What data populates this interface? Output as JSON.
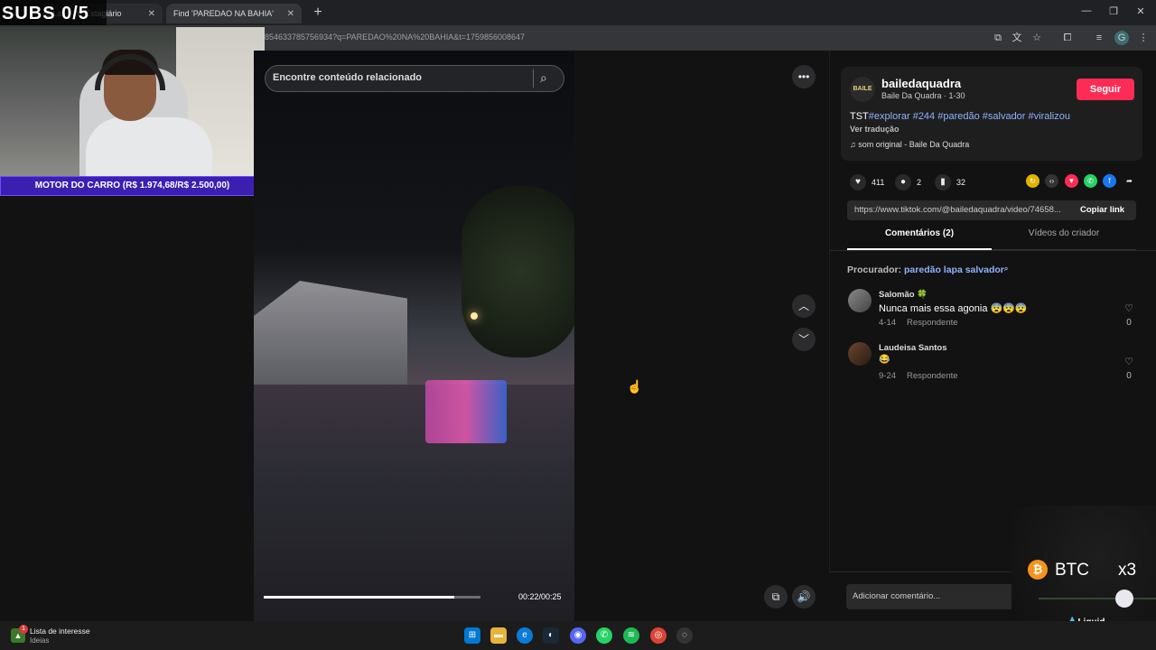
{
  "browser": {
    "tabs": [
      {
        "label": "0) Lar... W: Estagiário",
        "close": "✕"
      },
      {
        "label": "Find 'PAREDAO NA BAHIA'",
        "close": "✕"
      }
    ],
    "url": "854633785756934?q=PAREDAO%20NA%20BAHIA&t=1759856008647"
  },
  "overlay": {
    "subs_counter": "SUBS 0/5",
    "goal": "MOTOR DO CARRO (R$ 1.974,68/R$ 2.500,00)"
  },
  "video": {
    "search_placeholder": "Encontre conteúdo relacionado",
    "time": "00:22/00:25",
    "progress": 0.88
  },
  "post": {
    "username": "bailedaquadra",
    "avatar_text": "BAILE",
    "subtitle": "Baile Da Quadra · 1-30",
    "follow_label": "Seguir",
    "caption_prefix": "TST",
    "caption_tags": "#explorar #244 #paredão #salvador #viralizou",
    "translate": "Ver tradução",
    "music": "♫  som original - Baile Da Quadra",
    "likes": "411",
    "comments": "2",
    "saves": "32",
    "link": "https://www.tiktok.com/@bailedaquadra/video/74658...",
    "copy_link": "Copiar link"
  },
  "tabs": {
    "comments": "Comentários (2)",
    "videos": "Vídeos do criador"
  },
  "search_suggestion": {
    "label": "Procurador: ",
    "query": "paredão lapa salvador"
  },
  "comments": [
    {
      "name": "Salomão 🍀",
      "text": "Nunca mais essa agonia 😨😨😨",
      "date": "4-14",
      "reply": "Respondente",
      "likes": "0"
    },
    {
      "name": "Laudeisa Santos",
      "text": "😂",
      "date": "9-24",
      "reply": "Respondente",
      "likes": "0"
    }
  ],
  "add_comment": "Adicionar comentário...",
  "btc": {
    "label": "BTC",
    "multiplier": "x3",
    "brand": "💧Liquid",
    "icon": "₿"
  },
  "taskbar": {
    "widget_title": "Lista de interesse",
    "widget_sub": "Ideias",
    "widget_badge": "1"
  },
  "colors": {
    "follow": "#fe2c55",
    "tag": "#8fb2ff",
    "goal_bar": "#3b1fb0",
    "btc": "#f7931a"
  }
}
